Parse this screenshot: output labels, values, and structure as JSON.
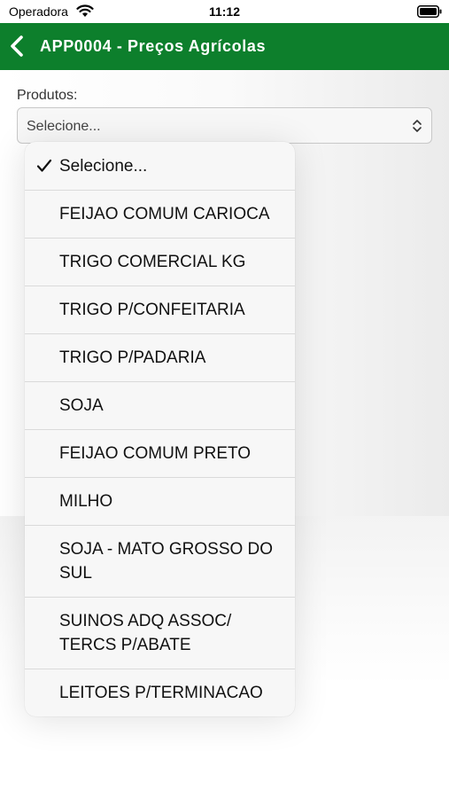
{
  "status_bar": {
    "carrier": "Operadora",
    "time": "11:12"
  },
  "nav": {
    "title": "APP0004 - Preços Agrícolas"
  },
  "form": {
    "label": "Produtos:",
    "selected_value": "Selecione..."
  },
  "dropdown": {
    "options": [
      {
        "label": "Selecione...",
        "checked": true
      },
      {
        "label": "FEIJAO COMUM CARIOCA"
      },
      {
        "label": "TRIGO COMERCIAL KG"
      },
      {
        "label": "TRIGO P/CONFEITARIA"
      },
      {
        "label": "TRIGO P/PADARIA"
      },
      {
        "label": "SOJA"
      },
      {
        "label": "FEIJAO COMUM PRETO"
      },
      {
        "label": "MILHO"
      },
      {
        "label": "SOJA - MATO GROSSO DO SUL"
      },
      {
        "label": "SUINOS ADQ ASSOC/ TERCS P/ABATE"
      },
      {
        "label": "LEITOES P/TERMINACAO"
      }
    ]
  },
  "colors": {
    "nav_green": "#0d7f2c"
  },
  "icons": [
    "wifi-icon",
    "battery-icon",
    "back-icon",
    "updown-icon",
    "check-icon"
  ]
}
